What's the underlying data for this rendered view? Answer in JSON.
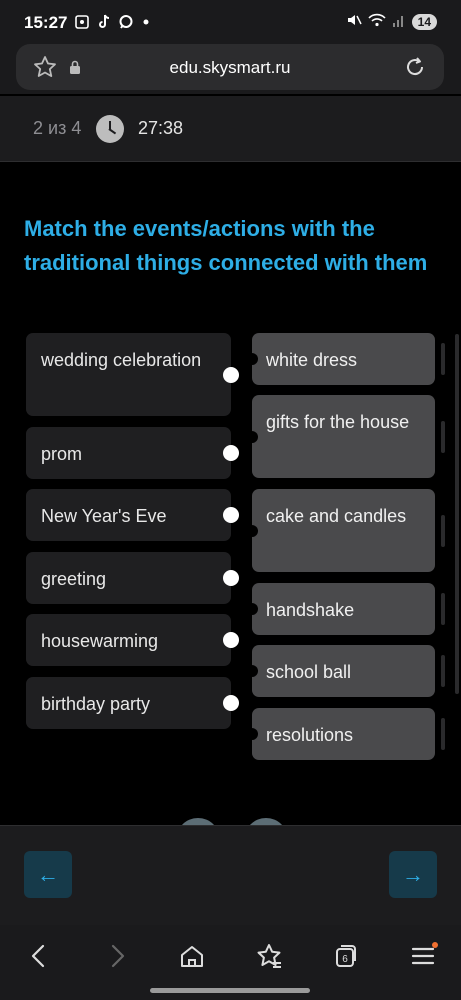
{
  "status_bar": {
    "time": "15:27",
    "left_icons": [
      "screenshot-icon",
      "tiktok-icon",
      "chat-icon",
      "dot-icon"
    ],
    "right_icons": [
      "mute-icon",
      "wifi-icon",
      "signal-icon"
    ],
    "battery": "14"
  },
  "browser": {
    "url": "edu.skysmart.ru",
    "tabs_count": "6"
  },
  "lesson": {
    "progress": "2 из 4",
    "timer": "27:38"
  },
  "task": {
    "title": "Match the events/actions with the traditional things connected with them",
    "left_items": [
      "wedding celebration",
      "prom",
      "New Year's Eve",
      "greeting",
      "housewarming",
      "birthday party"
    ],
    "right_items": [
      "white dress",
      "gifts for the house",
      "cake and candles",
      "handshake",
      "school ball",
      "resolutions"
    ]
  },
  "nav": {
    "prev_icon": "←",
    "next_icon": "→"
  },
  "colors": {
    "accent": "#2eaee6",
    "background": "#000000",
    "left_card": "#1f1f21",
    "right_card": "#4a4a4c"
  }
}
